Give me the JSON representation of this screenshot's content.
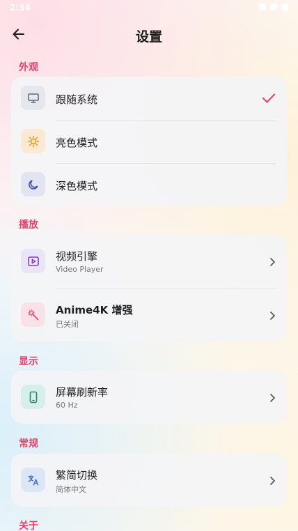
{
  "status_bar": {
    "time": "2:34"
  },
  "header": {
    "title": "设置"
  },
  "colors": {
    "accent": "#e8406a"
  },
  "sections": {
    "appearance": {
      "label": "外观",
      "options": [
        {
          "label": "跟随系统",
          "icon": "monitor-icon",
          "selected": true
        },
        {
          "label": "亮色模式",
          "icon": "sun-icon",
          "selected": false
        },
        {
          "label": "深色模式",
          "icon": "moon-icon",
          "selected": false
        }
      ]
    },
    "playback": {
      "label": "播放",
      "items": [
        {
          "title": "视频引擎",
          "subtitle": "Video Player",
          "icon": "play-icon"
        },
        {
          "title": "Anime4K 增强",
          "subtitle": "已关闭",
          "icon": "magic-wand-icon"
        }
      ]
    },
    "display": {
      "label": "显示",
      "items": [
        {
          "title": "屏幕刷新率",
          "subtitle": "60 Hz",
          "icon": "phone-icon"
        }
      ]
    },
    "general": {
      "label": "常规",
      "items": [
        {
          "title": "繁简切换",
          "subtitle": "简体中文",
          "icon": "translate-icon"
        }
      ]
    },
    "about": {
      "label": "关于"
    }
  }
}
